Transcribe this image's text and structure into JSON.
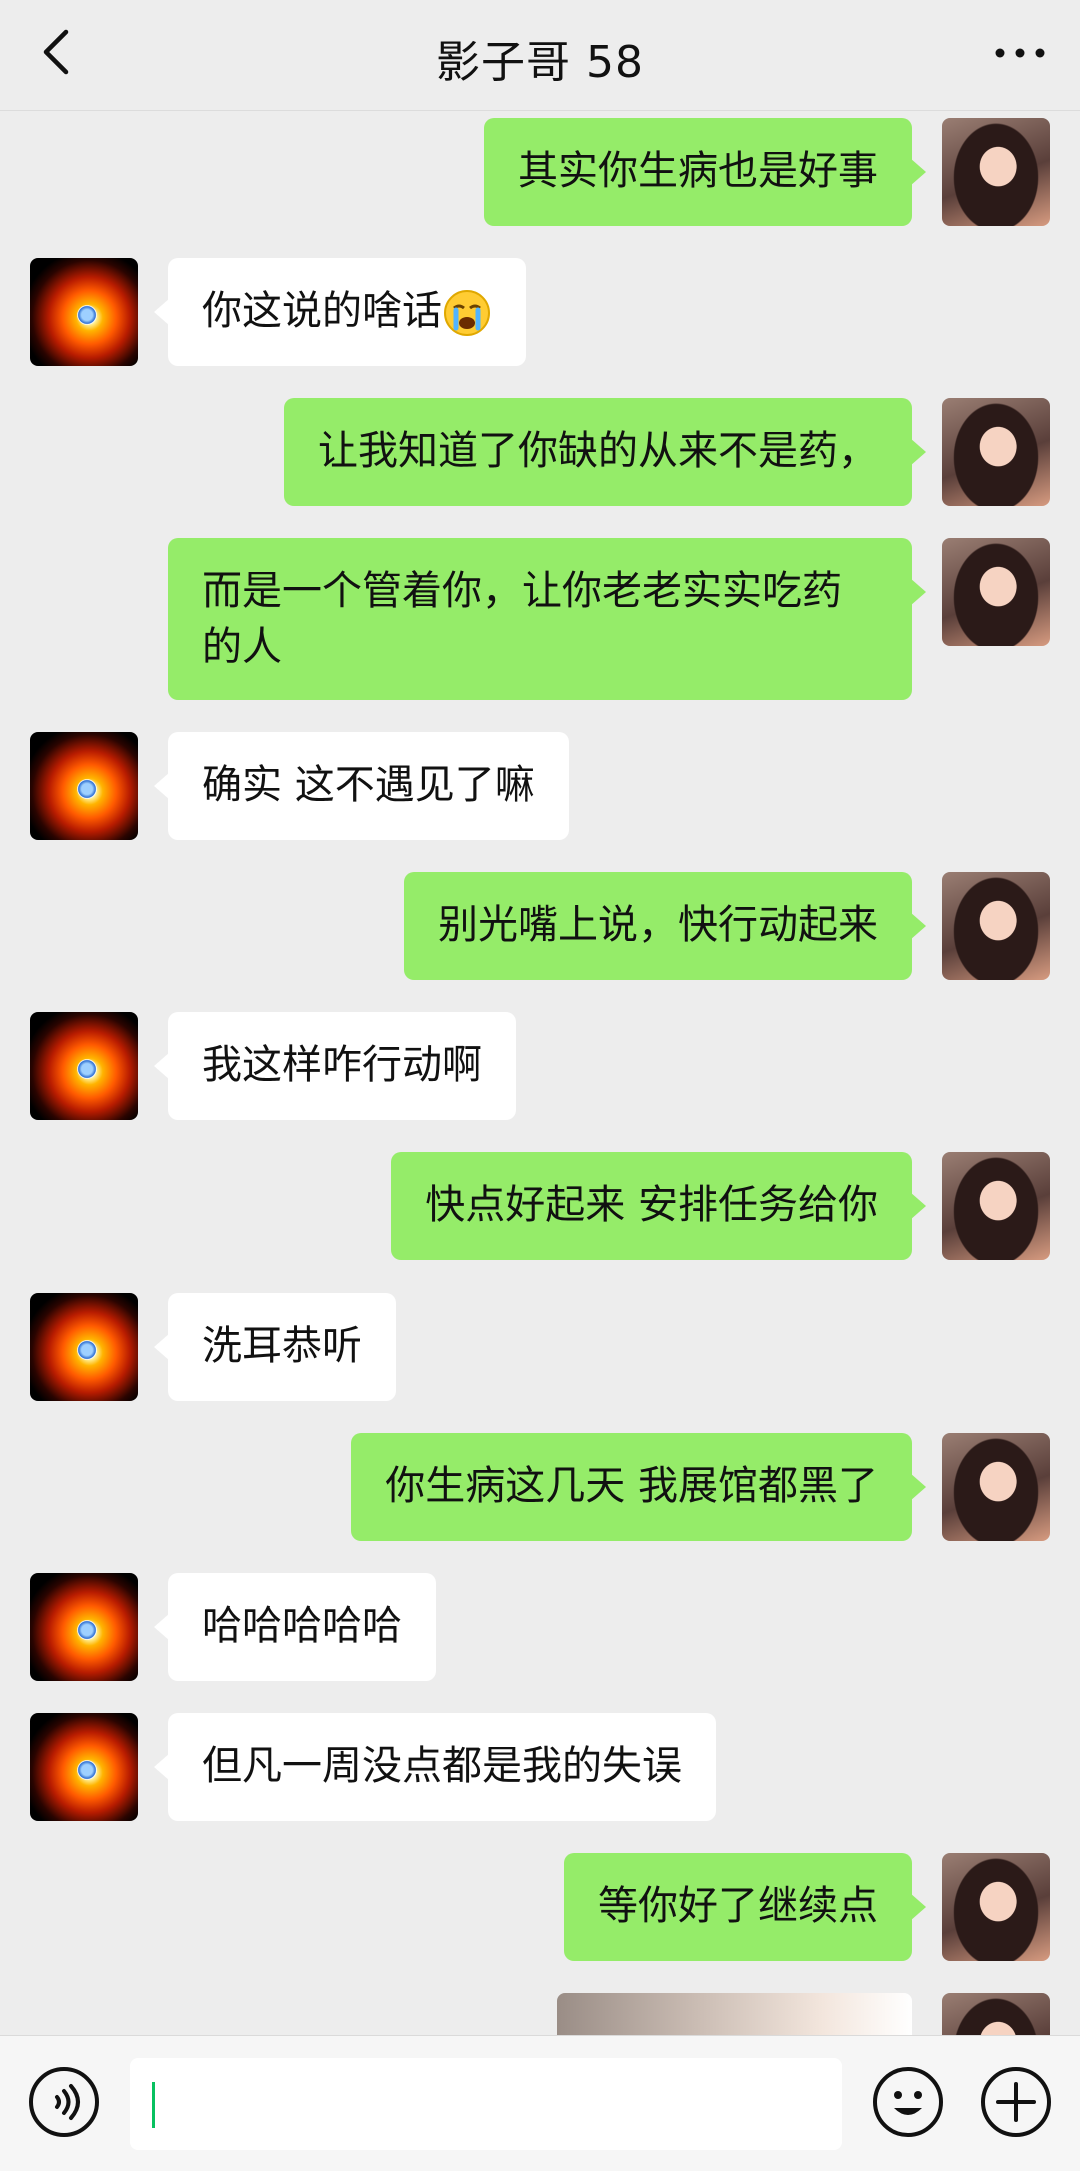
{
  "header": {
    "title": "影子哥 58"
  },
  "messages": [
    {
      "side": "out",
      "text": "其实你生病也是好事"
    },
    {
      "side": "in",
      "text": "你这说的啥话",
      "emoji": "crying-face"
    },
    {
      "side": "out",
      "text": "让我知道了你缺的从来不是药，"
    },
    {
      "side": "out",
      "text": "而是一个管着你，让你老老实实吃药的人"
    },
    {
      "side": "in",
      "text": "确实 这不遇见了嘛"
    },
    {
      "side": "out",
      "text": "别光嘴上说，快行动起来"
    },
    {
      "side": "in",
      "text": "我这样咋行动啊"
    },
    {
      "side": "out",
      "text": "快点好起来 安排任务给你"
    },
    {
      "side": "in",
      "text": "洗耳恭听"
    },
    {
      "side": "out",
      "text": "你生病这几天 我展馆都黑了"
    },
    {
      "side": "in",
      "text": "哈哈哈哈哈"
    },
    {
      "side": "in",
      "text": "但凡一周没点都是我的失误"
    },
    {
      "side": "out",
      "text": "等你好了继续点"
    },
    {
      "side": "out",
      "type": "image"
    }
  ],
  "input": {
    "value": ""
  },
  "icons": {
    "back": "chevron-left-icon",
    "more": "more-dots-icon",
    "voice": "voice-icon",
    "emoji": "smiley-icon",
    "plus": "plus-icon"
  },
  "colors": {
    "outgoing_bubble": "#95ec69",
    "incoming_bubble": "#ffffff",
    "background": "#ededed"
  }
}
